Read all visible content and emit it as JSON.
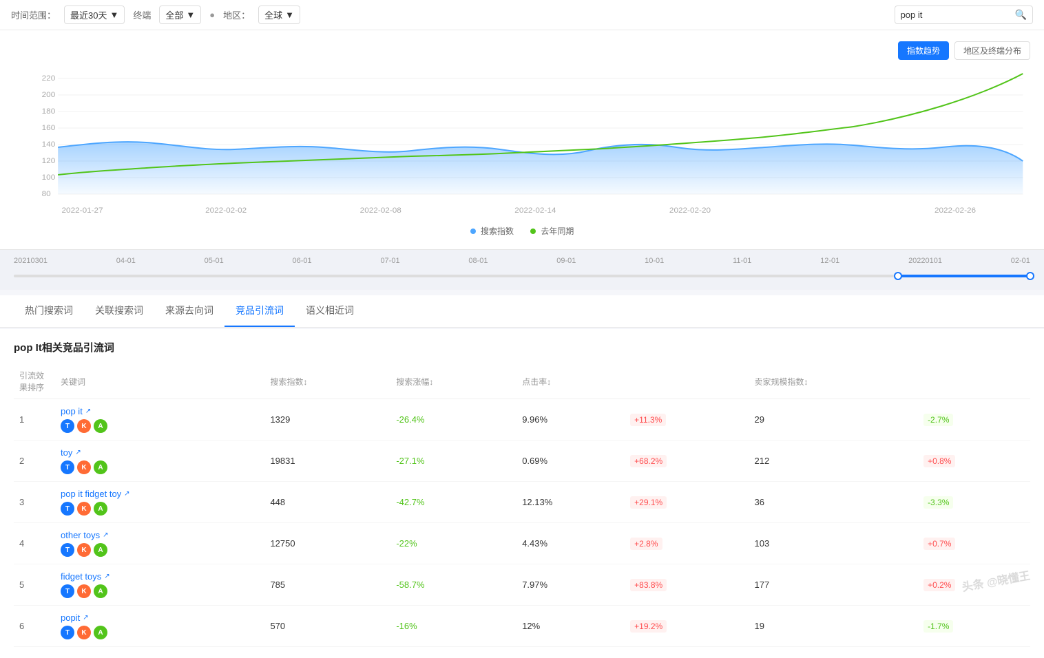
{
  "topbar": {
    "time_label": "时间范围：",
    "time_value": "最近30天",
    "terminal_label": "终端",
    "terminal_value": "全部",
    "region_dot": "●",
    "region_label": "地区：",
    "region_value": "全球",
    "search_value": "pop it"
  },
  "chart": {
    "tabs": [
      {
        "label": "指数趋势",
        "active": true
      },
      {
        "label": "地区及终端分布",
        "active": false
      }
    ],
    "legend": [
      {
        "label": "搜索指数",
        "color": "#4da6ff"
      },
      {
        "label": "去年同期",
        "color": "#52c41a"
      }
    ],
    "x_labels": [
      "2022-01-27",
      "2022-02-02",
      "2022-02-08",
      "2022-02-14",
      "2022-02-20",
      "2022-02-26"
    ],
    "y_labels": [
      "220",
      "200",
      "180",
      "160",
      "140",
      "120",
      "100",
      "80"
    ]
  },
  "timeline": {
    "dates": [
      "20210301",
      "04-01",
      "05-01",
      "06-01",
      "07-01",
      "08-01",
      "09-01",
      "10-01",
      "11-01",
      "12-01",
      "20220101",
      "02-01"
    ]
  },
  "tabs": [
    {
      "label": "热门搜索词",
      "active": false
    },
    {
      "label": "关联搜索词",
      "active": false
    },
    {
      "label": "来源去向词",
      "active": false
    },
    {
      "label": "竞品引流词",
      "active": true
    },
    {
      "label": "语义相近词",
      "active": false
    }
  ],
  "table": {
    "title": "pop It相关竞品引流词",
    "headers": [
      "引流效果排序",
      "关键词",
      "搜索指数↕",
      "搜索涨幅↕",
      "点击率↕",
      "",
      "卖家规模指数↕",
      ""
    ],
    "rows": [
      {
        "rank": "1",
        "keyword": "pop it",
        "badges": [
          "T",
          "K",
          "A"
        ],
        "search_index": "1329",
        "search_change": "-26.4%",
        "ctr": "9.96%",
        "ctr_change": "+11.3%",
        "ctr_change_type": "pos",
        "seller_index": "29",
        "seller_change": "-2.7%",
        "seller_change_type": "neg"
      },
      {
        "rank": "2",
        "keyword": "toy",
        "badges": [
          "T",
          "K",
          "A"
        ],
        "search_index": "19831",
        "search_change": "-27.1%",
        "ctr": "0.69%",
        "ctr_change": "+68.2%",
        "ctr_change_type": "pos",
        "seller_index": "212",
        "seller_change": "+0.8%",
        "seller_change_type": "pos"
      },
      {
        "rank": "3",
        "keyword": "pop it fidget toy",
        "badges": [
          "T",
          "K",
          "A"
        ],
        "search_index": "448",
        "search_change": "-42.7%",
        "ctr": "12.13%",
        "ctr_change": "+29.1%",
        "ctr_change_type": "pos",
        "seller_index": "36",
        "seller_change": "-3.3%",
        "seller_change_type": "neg"
      },
      {
        "rank": "4",
        "keyword": "other toys",
        "badges": [
          "T",
          "K",
          "A"
        ],
        "search_index": "12750",
        "search_change": "-22%",
        "ctr": "4.43%",
        "ctr_change": "+2.8%",
        "ctr_change_type": "pos",
        "seller_index": "103",
        "seller_change": "+0.7%",
        "seller_change_type": "pos"
      },
      {
        "rank": "5",
        "keyword": "fidget toys",
        "badges": [
          "T",
          "K",
          "A"
        ],
        "search_index": "785",
        "search_change": "-58.7%",
        "ctr": "7.97%",
        "ctr_change": "+83.8%",
        "ctr_change_type": "pos",
        "seller_index": "177",
        "seller_change": "+0.2%",
        "seller_change_type": "pos"
      },
      {
        "rank": "6",
        "keyword": "popit",
        "badges": [
          "T",
          "K",
          "A"
        ],
        "search_index": "570",
        "search_change": "-16%",
        "ctr": "12%",
        "ctr_change": "+19.2%",
        "ctr_change_type": "pos",
        "seller_index": "19",
        "seller_change": "-1.7%",
        "seller_change_type": "neg"
      }
    ]
  },
  "watermark": "头条 @晓懂王"
}
